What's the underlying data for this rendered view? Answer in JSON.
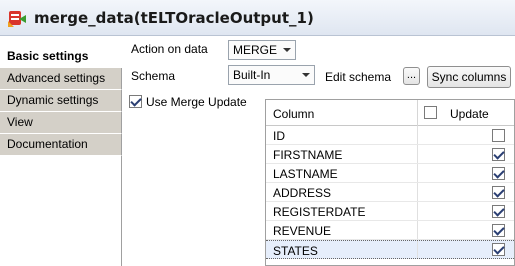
{
  "title": "merge_data(tELTOracleOutput_1)",
  "tabs": [
    {
      "label": "Basic settings",
      "active": true
    },
    {
      "label": "Advanced settings",
      "active": false
    },
    {
      "label": "Dynamic settings",
      "active": false
    },
    {
      "label": "View",
      "active": false
    },
    {
      "label": "Documentation",
      "active": false
    }
  ],
  "form": {
    "action_label": "Action on data",
    "action_value": "MERGE",
    "schema_label": "Schema",
    "schema_value": "Built-In",
    "edit_schema_label": "Edit schema",
    "edit_schema_button": "...",
    "sync_columns_button": "Sync columns",
    "use_merge_update_label": "Use Merge Update",
    "use_merge_update_checked": true
  },
  "table": {
    "col_header": "Column",
    "update_header": "Update",
    "rows": [
      {
        "name": "ID",
        "update": false
      },
      {
        "name": "FIRSTNAME",
        "update": true
      },
      {
        "name": "LASTNAME",
        "update": true
      },
      {
        "name": "ADDRESS",
        "update": true
      },
      {
        "name": "REGISTERDATE",
        "update": true
      },
      {
        "name": "REVENUE",
        "update": true
      },
      {
        "name": "STATES",
        "update": true
      }
    ]
  },
  "colors": {
    "title_bg": "#dfe6f1",
    "tab_bg": "#d4d0c8",
    "selected_row": "#e6eefb"
  }
}
